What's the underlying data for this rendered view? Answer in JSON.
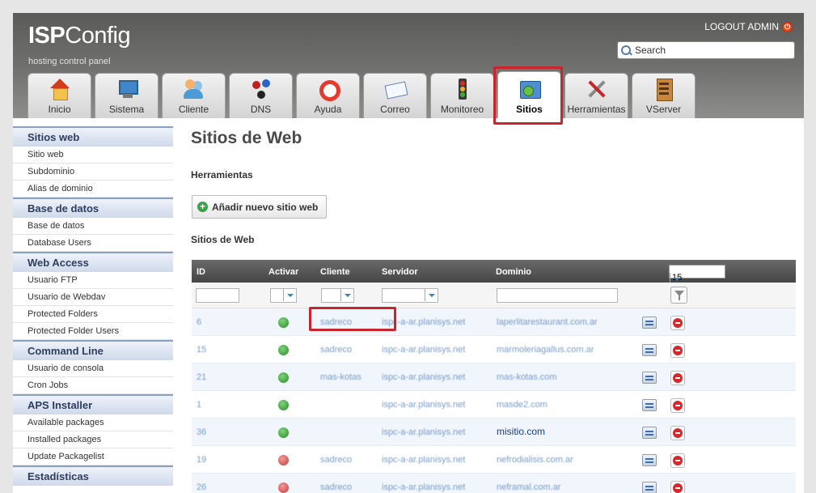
{
  "header": {
    "logo_bold": "ISP",
    "logo_light": "Config",
    "tagline": "hosting control panel",
    "logout": "LOGOUT ADMIN",
    "search_placeholder": "Search"
  },
  "tabs": [
    {
      "label": "Inicio",
      "icon": "home-icon"
    },
    {
      "label": "Sistema",
      "icon": "system-icon"
    },
    {
      "label": "Cliente",
      "icon": "client-icon"
    },
    {
      "label": "DNS",
      "icon": "dns-icon"
    },
    {
      "label": "Ayuda",
      "icon": "help-icon"
    },
    {
      "label": "Correo",
      "icon": "mail-icon"
    },
    {
      "label": "Monitoreo",
      "icon": "monitor-icon"
    },
    {
      "label": "Sitios",
      "icon": "sites-icon",
      "active": true
    },
    {
      "label": "Herramientas",
      "icon": "tools-icon"
    },
    {
      "label": "VServer",
      "icon": "vserver-icon"
    }
  ],
  "sidebar": {
    "groups": [
      {
        "title": "Sitios web",
        "items": [
          "Sitio web",
          "Subdominio",
          "Alias de dominio"
        ]
      },
      {
        "title": "Base de datos",
        "items": [
          "Base de datos",
          "Database Users"
        ]
      },
      {
        "title": "Web Access",
        "items": [
          "Usuario FTP",
          "Usuario de Webdav",
          "Protected Folders",
          "Protected Folder Users"
        ]
      },
      {
        "title": "Command Line",
        "items": [
          "Usuario de consola",
          "Cron Jobs"
        ]
      },
      {
        "title": "APS Installer",
        "items": [
          "Available packages",
          "Installed packages",
          "Update Packagelist"
        ]
      },
      {
        "title": "Estadísticas",
        "items": []
      }
    ]
  },
  "main": {
    "title": "Sitios de Web",
    "tools_label": "Herramientas",
    "add_button": "Añadir nuevo sitio web",
    "list_label": "Sitios de Web"
  },
  "table": {
    "columns": [
      "ID",
      "Activar",
      "Cliente",
      "Servidor",
      "Dominio"
    ],
    "per_page": "15",
    "rows": [
      {
        "id": "6",
        "active": true,
        "client": "sadreco",
        "server": "ispc-a-ar.planisys.net",
        "domain": "laperlitarestaurant.com.ar"
      },
      {
        "id": "15",
        "active": true,
        "client": "sadreco",
        "server": "ispc-a-ar.planisys.net",
        "domain": "marmoleriagallus.com.ar"
      },
      {
        "id": "21",
        "active": true,
        "client": "mas-kotas",
        "server": "ispc-a-ar.planisys.net",
        "domain": "mas-kotas.com"
      },
      {
        "id": "1",
        "active": true,
        "client": "",
        "server": "ispc-a-ar.planisys.net",
        "domain": "masde2.com"
      },
      {
        "id": "36",
        "active": true,
        "client": "",
        "server": "ispc-a-ar.planisys.net",
        "domain": "misitio.com",
        "highlight": true
      },
      {
        "id": "19",
        "active": false,
        "client": "sadreco",
        "server": "ispc-a-ar.planisys.net",
        "domain": "nefrodialisis.com.ar"
      },
      {
        "id": "26",
        "active": false,
        "client": "sadreco",
        "server": "ispc-a-ar.planisys.net",
        "domain": "neframal.com.ar"
      }
    ]
  }
}
